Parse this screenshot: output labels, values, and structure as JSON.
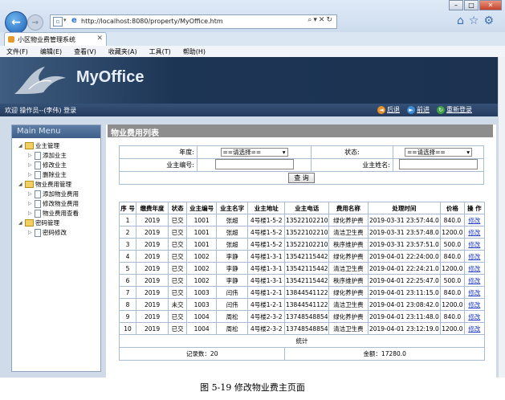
{
  "browser": {
    "url": "http://localhost:8080/property/MyOffice.htm",
    "tab_title": "小区物业费管理系统",
    "menu": [
      "文件(F)",
      "编辑(E)",
      "查看(V)",
      "收藏夹(A)",
      "工具(T)",
      "帮助(H)"
    ]
  },
  "header": {
    "logo": "MyOffice",
    "welcome": "欢迎 操作员--(李伟) 登录",
    "nav": [
      "后退",
      "前进",
      "重新登录"
    ]
  },
  "sidebar": {
    "title": "Main Menu",
    "groups": [
      {
        "label": "业主管理",
        "items": [
          "添加业主",
          "修改业主",
          "删除业主"
        ]
      },
      {
        "label": "物业费用管理",
        "items": [
          "添加物业费用",
          "修改物业费用",
          "物业费用查看"
        ]
      },
      {
        "label": "密码管理",
        "items": [
          "密码修改"
        ]
      }
    ]
  },
  "main": {
    "title": "物业费用列表",
    "filters": {
      "year_label": "年度:",
      "year_value": "==请选择==",
      "status_label": "状态:",
      "status_value": "==请选择==",
      "owner_no_label": "业主编号:",
      "owner_name_label": "业主姓名:",
      "query_button": "查 询"
    },
    "columns": [
      "序 号",
      "缴费年度",
      "状态",
      "业主编号",
      "业主名字",
      "业主地址",
      "业主电话",
      "费用名称",
      "处理时间",
      "价格",
      "操 作"
    ],
    "rows": [
      [
        "1",
        "2019",
        "已交",
        "1001",
        "张超",
        "4号楼1-5-2",
        "13522102210",
        "绿化养护费",
        "2019-03-31 23:57:44.0",
        "840.0",
        "修改"
      ],
      [
        "2",
        "2019",
        "已交",
        "1001",
        "张超",
        "4号楼1-5-2",
        "13522102210",
        "清洁卫生费",
        "2019-03-31 23:57:48.0",
        "1200.0",
        "修改"
      ],
      [
        "3",
        "2019",
        "已交",
        "1001",
        "张超",
        "4号楼1-5-2",
        "13522102210",
        "秩序维护费",
        "2019-03-31 23:57:51.0",
        "500.0",
        "修改"
      ],
      [
        "4",
        "2019",
        "已交",
        "1002",
        "李静",
        "4号楼1-3-1",
        "13542115442",
        "绿化养护费",
        "2019-04-01 22:24:00.0",
        "840.0",
        "修改"
      ],
      [
        "5",
        "2019",
        "已交",
        "1002",
        "李静",
        "4号楼1-3-1",
        "13542115442",
        "清洁卫生费",
        "2019-04-01 22:24:21.0",
        "1200.0",
        "修改"
      ],
      [
        "6",
        "2019",
        "已交",
        "1002",
        "李静",
        "4号楼1-3-1",
        "13542115442",
        "秩序维护费",
        "2019-04-01 22:25:47.0",
        "500.0",
        "修改"
      ],
      [
        "7",
        "2019",
        "已交",
        "1003",
        "闫伟",
        "4号楼1-2-1",
        "13844541122",
        "绿化养护费",
        "2019-04-01 23:11:15.0",
        "840.0",
        "修改"
      ],
      [
        "8",
        "2019",
        "未交",
        "1003",
        "闫伟",
        "4号楼1-2-1",
        "13844541122",
        "清洁卫生费",
        "2019-04-01 23:08:42.0",
        "1200.0",
        "修改"
      ],
      [
        "9",
        "2019",
        "已交",
        "1004",
        "周松",
        "4号楼2-3-2",
        "13748548854",
        "绿化养护费",
        "2019-04-01 23:11:48.0",
        "840.0",
        "修改"
      ],
      [
        "10",
        "2019",
        "已交",
        "1004",
        "周松",
        "4号楼2-3-2",
        "13748548854",
        "清洁卫生费",
        "2019-04-01 23:12:19.0",
        "1200.0",
        "修改"
      ]
    ],
    "stats_label": "统计",
    "record_count": "记录数：20",
    "amount": "金额：17280.0"
  },
  "caption": "图 5-19 修改物业费主页面"
}
